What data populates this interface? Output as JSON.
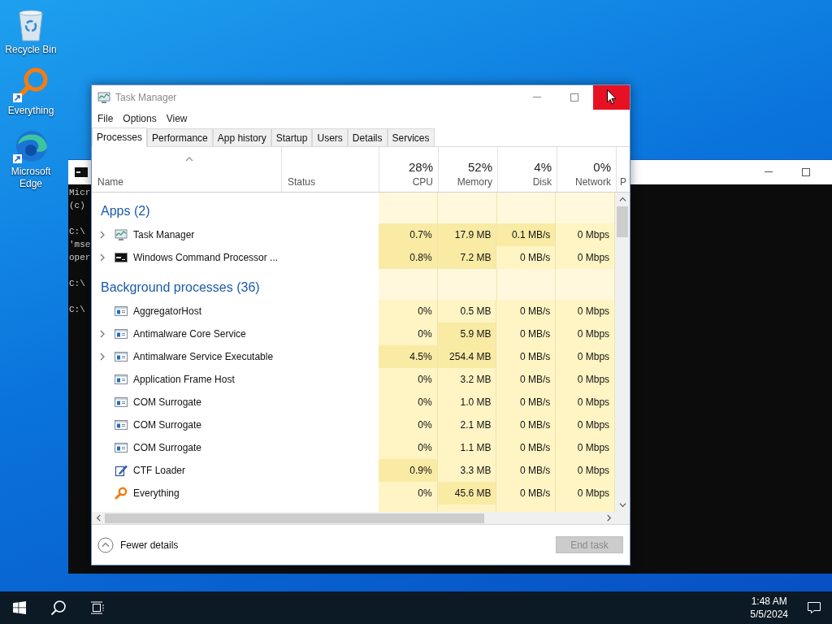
{
  "desktop": {
    "icons": [
      {
        "label": "Recycle Bin",
        "kind": "recycle-bin",
        "shortcut": false
      },
      {
        "label": "Everything",
        "kind": "everything",
        "shortcut": true
      },
      {
        "label": "Microsoft Edge",
        "kind": "edge",
        "shortcut": true
      }
    ]
  },
  "console_window": {
    "blocks": [
      [
        "Micr",
        "(c)"
      ],
      [
        "C:\\",
        "'mse",
        "oper"
      ],
      [
        "C:\\"
      ],
      [
        "C:\\"
      ]
    ]
  },
  "task_manager": {
    "title": "Task Manager",
    "close_hovered": true,
    "menu": [
      "File",
      "Options",
      "View"
    ],
    "tabs": [
      {
        "label": "Processes",
        "selected": true
      },
      {
        "label": "Performance",
        "selected": false
      },
      {
        "label": "App history",
        "selected": false
      },
      {
        "label": "Startup",
        "selected": false
      },
      {
        "label": "Users",
        "selected": false
      },
      {
        "label": "Details",
        "selected": false
      },
      {
        "label": "Services",
        "selected": false
      }
    ],
    "columns": [
      {
        "kind": "text",
        "label": "Name",
        "sorted": true
      },
      {
        "kind": "text",
        "label": "Status",
        "sorted": false
      },
      {
        "kind": "metric",
        "usage": "28%",
        "label": "CPU",
        "sorted": false
      },
      {
        "kind": "metric",
        "usage": "52%",
        "label": "Memory",
        "sorted": false
      },
      {
        "kind": "metric",
        "usage": "4%",
        "label": "Disk",
        "sorted": false
      },
      {
        "kind": "metric",
        "usage": "0%",
        "label": "Network",
        "sorted": false
      },
      {
        "kind": "cut",
        "label": "P",
        "sorted": false
      }
    ],
    "groups": [
      {
        "title": "Apps (2)",
        "rows": [
          {
            "name": "Task Manager",
            "kind": "task-manager",
            "expandable": true,
            "cells": [
              {
                "text": "0.7%",
                "highlighted": true
              },
              {
                "text": "17.9 MB",
                "highlighted": true
              },
              {
                "text": "0.1 MB/s",
                "highlighted": true
              },
              {
                "text": "0 Mbps",
                "highlighted": false
              }
            ]
          },
          {
            "name": "Windows Command Processor ...",
            "kind": "cmd",
            "expandable": true,
            "cells": [
              {
                "text": "0.8%",
                "highlighted": true
              },
              {
                "text": "7.2 MB",
                "highlighted": true
              },
              {
                "text": "0 MB/s",
                "highlighted": false
              },
              {
                "text": "0 Mbps",
                "highlighted": false
              }
            ]
          }
        ]
      },
      {
        "title": "Background processes (36)",
        "rows": [
          {
            "name": "AggregatorHost",
            "kind": "service",
            "expandable": false,
            "cells": [
              {
                "text": "0%",
                "highlighted": false
              },
              {
                "text": "0.5 MB",
                "highlighted": false
              },
              {
                "text": "0 MB/s",
                "highlighted": false
              },
              {
                "text": "0 Mbps",
                "highlighted": false
              }
            ]
          },
          {
            "name": "Antimalware Core Service",
            "kind": "service",
            "expandable": true,
            "cells": [
              {
                "text": "0%",
                "highlighted": false
              },
              {
                "text": "5.9 MB",
                "highlighted": true
              },
              {
                "text": "0 MB/s",
                "highlighted": false
              },
              {
                "text": "0 Mbps",
                "highlighted": false
              }
            ]
          },
          {
            "name": "Antimalware Service Executable",
            "kind": "service",
            "expandable": true,
            "cells": [
              {
                "text": "4.5%",
                "highlighted": true
              },
              {
                "text": "254.4 MB",
                "highlighted": true
              },
              {
                "text": "0 MB/s",
                "highlighted": false
              },
              {
                "text": "0 Mbps",
                "highlighted": false
              }
            ]
          },
          {
            "name": "Application Frame Host",
            "kind": "service",
            "expandable": false,
            "cells": [
              {
                "text": "0%",
                "highlighted": false
              },
              {
                "text": "3.2 MB",
                "highlighted": false
              },
              {
                "text": "0 MB/s",
                "highlighted": false
              },
              {
                "text": "0 Mbps",
                "highlighted": false
              }
            ]
          },
          {
            "name": "COM Surrogate",
            "kind": "service",
            "expandable": false,
            "cells": [
              {
                "text": "0%",
                "highlighted": false
              },
              {
                "text": "1.0 MB",
                "highlighted": false
              },
              {
                "text": "0 MB/s",
                "highlighted": false
              },
              {
                "text": "0 Mbps",
                "highlighted": false
              }
            ]
          },
          {
            "name": "COM Surrogate",
            "kind": "service",
            "expandable": false,
            "cells": [
              {
                "text": "0%",
                "highlighted": false
              },
              {
                "text": "2.1 MB",
                "highlighted": false
              },
              {
                "text": "0 MB/s",
                "highlighted": false
              },
              {
                "text": "0 Mbps",
                "highlighted": false
              }
            ]
          },
          {
            "name": "COM Surrogate",
            "kind": "service",
            "expandable": false,
            "cells": [
              {
                "text": "0%",
                "highlighted": false
              },
              {
                "text": "1.1 MB",
                "highlighted": false
              },
              {
                "text": "0 MB/s",
                "highlighted": false
              },
              {
                "text": "0 Mbps",
                "highlighted": false
              }
            ]
          },
          {
            "name": "CTF Loader",
            "kind": "ctf",
            "expandable": false,
            "cells": [
              {
                "text": "0.9%",
                "highlighted": true
              },
              {
                "text": "3.3 MB",
                "highlighted": false
              },
              {
                "text": "0 MB/s",
                "highlighted": false
              },
              {
                "text": "0 Mbps",
                "highlighted": false
              }
            ]
          },
          {
            "name": "Everything",
            "kind": "everything",
            "expandable": false,
            "cells": [
              {
                "text": "0%",
                "highlighted": false
              },
              {
                "text": "45.6 MB",
                "highlighted": true
              },
              {
                "text": "0 MB/s",
                "highlighted": false
              },
              {
                "text": "0 Mbps",
                "highlighted": false
              }
            ]
          }
        ]
      }
    ],
    "footer": {
      "toggle": "Fewer details",
      "end_task": {
        "label": "End task",
        "disabled": true
      }
    }
  },
  "taskbar": {
    "time": "1:48 AM",
    "date": "5/5/2024"
  }
}
